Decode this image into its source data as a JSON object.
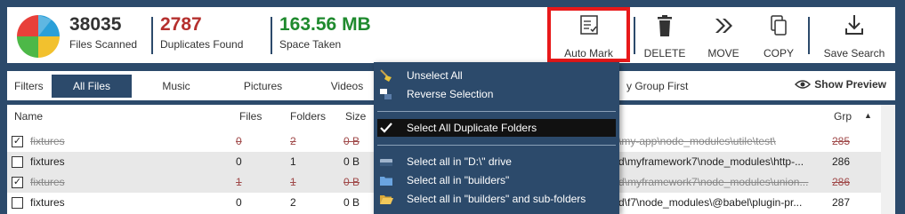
{
  "stats": {
    "files_scanned": {
      "value": "38035",
      "label": "Files Scanned",
      "color": "#333333"
    },
    "duplicates_found": {
      "value": "2787",
      "label": "Duplicates Found",
      "color": "#b5302e"
    },
    "space_taken": {
      "value": "163.56 MB",
      "label": "Space Taken",
      "color": "#1f8a2e"
    }
  },
  "toolbar": {
    "auto_mark": "Auto Mark",
    "delete": "DELETE",
    "move": "MOVE",
    "copy": "COPY",
    "save_search": "Save Search"
  },
  "filters": {
    "label": "Filters",
    "tabs": [
      "All Files",
      "Music",
      "Pictures",
      "Videos"
    ],
    "active_tab": "All Files",
    "group_first": "y Group First",
    "show_preview": "Show Preview"
  },
  "table": {
    "columns": {
      "name": "Name",
      "files": "Files",
      "folders": "Folders",
      "size": "Size",
      "grp": "Grp"
    },
    "rows": [
      {
        "checked": true,
        "name": "fixtures",
        "files": "0",
        "folders": "2",
        "size": "0 B",
        "path": "\\my-app\\node_modules\\utile\\test\\",
        "grp": "285",
        "struck": true
      },
      {
        "checked": false,
        "name": "fixtures",
        "files": "0",
        "folders": "1",
        "size": "0 B",
        "path": "d\\myframework7\\node_modules\\http-...",
        "grp": "286",
        "struck": false
      },
      {
        "checked": true,
        "name": "fixtures",
        "files": "1",
        "folders": "1",
        "size": "0 B",
        "path": "d\\myframework7\\node_modules\\union...",
        "grp": "286",
        "struck": true
      },
      {
        "checked": false,
        "name": "fixtures",
        "files": "0",
        "folders": "2",
        "size": "0 B",
        "path": "d\\f7\\node_modules\\@babel\\plugin-pr...",
        "grp": "287",
        "struck": false
      }
    ]
  },
  "menu": {
    "unselect_all": "Unselect All",
    "reverse_selection": "Reverse Selection",
    "select_all_duplicate_folders": "Select All Duplicate Folders",
    "select_all_in_drive": "Select all in \"D:\\\" drive",
    "select_all_in_builders": "Select all in \"builders\"",
    "select_all_in_builders_sub": "Select all in \"builders\" and sub-folders"
  }
}
